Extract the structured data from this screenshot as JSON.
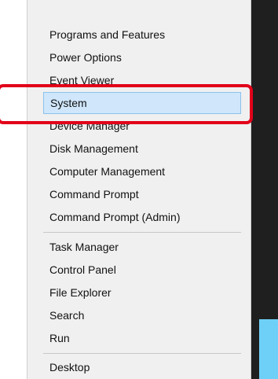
{
  "menu": {
    "groups": [
      {
        "items": [
          {
            "label": "Programs and Features"
          },
          {
            "label": "Power Options"
          },
          {
            "label": "Event Viewer"
          },
          {
            "label": "System",
            "selected": true
          },
          {
            "label": "Device Manager"
          },
          {
            "label": "Disk Management"
          },
          {
            "label": "Computer Management"
          },
          {
            "label": "Command Prompt"
          },
          {
            "label": "Command Prompt (Admin)"
          }
        ]
      },
      {
        "items": [
          {
            "label": "Task Manager"
          },
          {
            "label": "Control Panel"
          },
          {
            "label": "File Explorer"
          },
          {
            "label": "Search"
          },
          {
            "label": "Run"
          }
        ]
      },
      {
        "items": [
          {
            "label": "Desktop"
          }
        ]
      }
    ]
  },
  "annotation": {
    "highlight_color": "#e2001a",
    "highlighted_item": "System"
  },
  "colors": {
    "menu_background": "#f0f0f0",
    "selected_background": "#cfe6fb",
    "selected_border": "#8bc2ec",
    "taskbar_accent": "#6fd0f7"
  }
}
